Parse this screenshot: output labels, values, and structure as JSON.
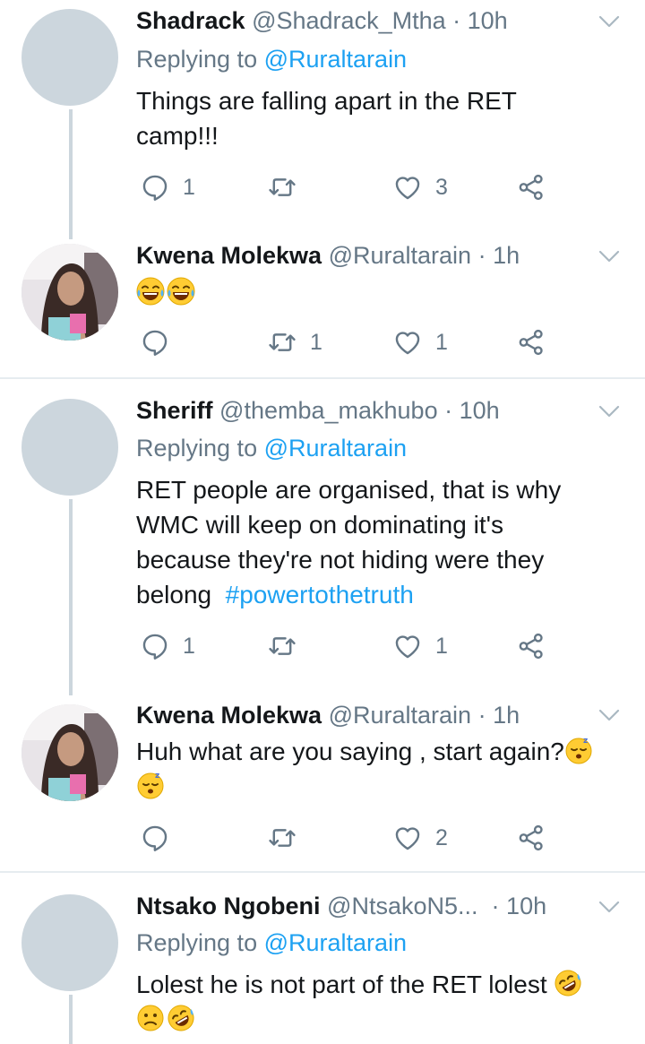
{
  "tweets": [
    {
      "name": "Shadrack",
      "handle": "@Shadrack_Mtha",
      "dot": "·",
      "time": "10h",
      "reply_prefix": "Replying to",
      "reply_to": "@Ruraltarain",
      "text_line1": "Things are falling apart in the RET",
      "text_line2": "camp!!!",
      "reply_count": "1",
      "retweet_count": "",
      "like_count": "3"
    },
    {
      "name": "Kwena Molekwa",
      "handle": "@Ruraltarain",
      "dot": "·",
      "time": "1h",
      "emojis": [
        "face-with-tears-of-joy",
        "face-with-tears-of-joy"
      ],
      "reply_count": "",
      "retweet_count": "1",
      "like_count": "1"
    },
    {
      "name": "Sheriff",
      "handle": "@themba_makhubo",
      "dot": "·",
      "time": "10h",
      "reply_prefix": "Replying to",
      "reply_to": "@Ruraltarain",
      "text_line1": "RET people  are organised, that is why",
      "text_line2": "WMC will keep on dominating it's",
      "text_line3": "because they're  not hiding were they",
      "text_line4": "belong",
      "hashtag": "#powertothetruth",
      "reply_count": "1",
      "retweet_count": "",
      "like_count": "1"
    },
    {
      "name": "Kwena Molekwa",
      "handle": "@Ruraltarain",
      "dot": "·",
      "time": "1h",
      "text_line1": "Huh what are you saying , start again?",
      "emojis": [
        "sleeping-face",
        "sleeping-face"
      ],
      "reply_count": "",
      "retweet_count": "",
      "like_count": "2"
    },
    {
      "name": "Ntsako Ngobeni",
      "handle": "@NtsakoN5...",
      "dot": "·",
      "time": "10h",
      "reply_prefix": "Replying to",
      "reply_to": "@Ruraltarain",
      "text_line1": "Lolest he is not part of the RET lolest",
      "emojis": [
        "rolling-on-floor-laughing",
        "confused-face",
        "rolling-on-floor-laughing"
      ]
    }
  ],
  "colors": {
    "link": "#1da1f2",
    "secondary_text": "#657786",
    "avatar_placeholder": "#ccd6dd",
    "divider": "#e6ecf0"
  }
}
